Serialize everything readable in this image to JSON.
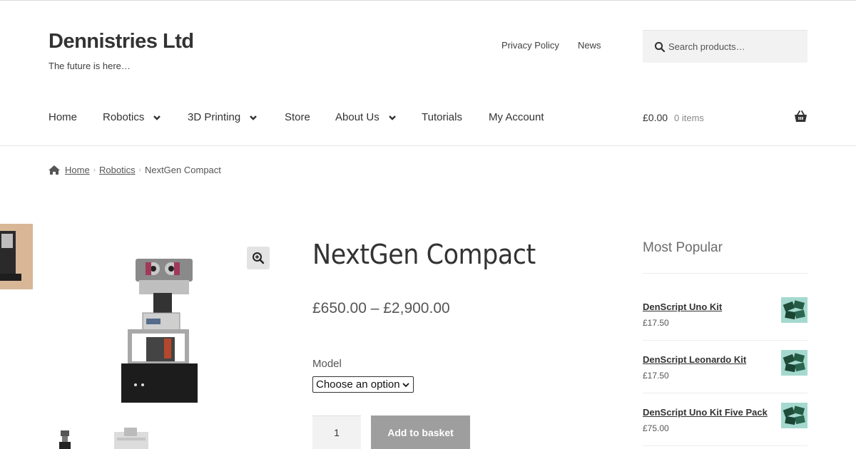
{
  "site": {
    "title": "Dennistries Ltd",
    "tagline": "The future is here…"
  },
  "secondary_nav": {
    "privacy": "Privacy Policy",
    "news": "News"
  },
  "search": {
    "placeholder": "Search products…"
  },
  "main_nav": {
    "home": "Home",
    "robotics": "Robotics",
    "printing": "3D Printing",
    "store": "Store",
    "about": "About Us",
    "tutorials": "Tutorials",
    "account": "My Account"
  },
  "cart": {
    "total": "£0.00",
    "count": "0 items"
  },
  "breadcrumb": {
    "home": "Home",
    "robotics": "Robotics",
    "current": "NextGen Compact"
  },
  "product": {
    "title": "NextGen Compact",
    "price": "£650.00 – £2,900.00",
    "model_label": "Model",
    "model_select": "Choose an option",
    "quantity": "1",
    "add_button": "Add to basket"
  },
  "widget": {
    "title": "Most Popular",
    "items": [
      {
        "name": "DenScript Uno Kit",
        "price": "£17.50"
      },
      {
        "name": "DenScript Leonardo Kit",
        "price": "£17.50"
      },
      {
        "name": "DenScript Uno Kit Five Pack",
        "price": "£75.00"
      }
    ]
  },
  "icons": {
    "search": "search-icon",
    "chevron": "chevron-down-icon",
    "basket": "basket-icon",
    "home": "home-icon",
    "zoom": "zoom-icon"
  },
  "colors": {
    "button": "#9e9e9e",
    "text": "#333333",
    "thumb_bg": "#a5d9cf"
  }
}
